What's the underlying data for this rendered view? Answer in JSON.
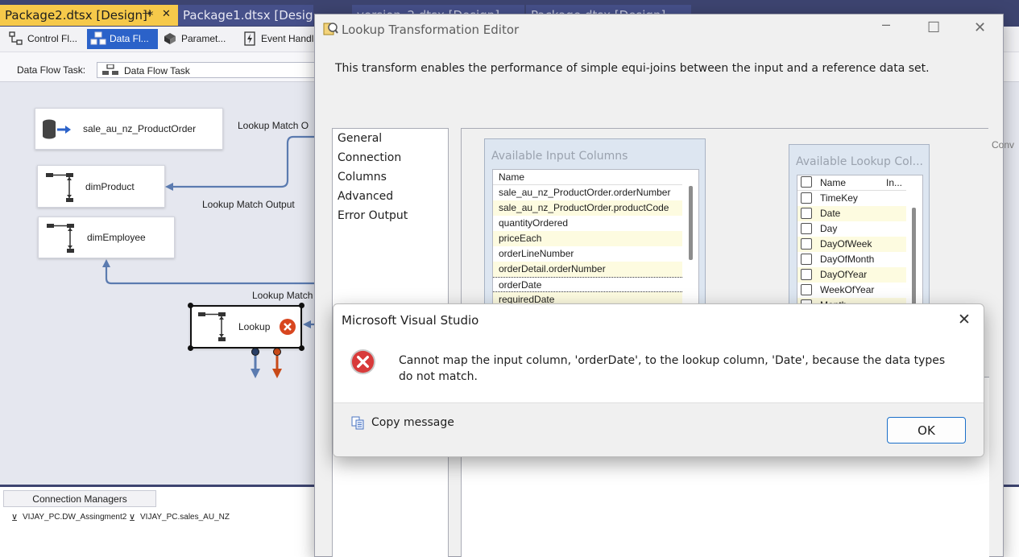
{
  "document_tabs": [
    {
      "label": "Package2.dtsx [Design]*",
      "active": true
    },
    {
      "label": "Package1.dtsx [Design]",
      "active": false
    },
    {
      "label": "version_2.dtsx [Design]",
      "active": false
    },
    {
      "label": "Package.dtsx [Design]",
      "active": false
    }
  ],
  "tab_controls": {
    "pin": "⊣",
    "close": "✕"
  },
  "designer_tabs": [
    {
      "label": "Control Fl...",
      "icon": "control-flow-icon"
    },
    {
      "label": "Data Fl...",
      "icon": "data-flow-icon",
      "active": true
    },
    {
      "label": "Paramet...",
      "icon": "parameters-icon"
    },
    {
      "label": "Event Handl...",
      "icon": "event-handlers-icon"
    }
  ],
  "task_bar": {
    "label": "Data Flow Task:",
    "value": "Data Flow Task"
  },
  "canvas": {
    "nodes": {
      "source": "sale_au_nz_ProductOrder",
      "dim_product": "dimProduct",
      "dim_employee": "dimEmployee",
      "lookup": "Lookup"
    },
    "flow_labels": {
      "top": "Lookup Match O",
      "middle": "Lookup Match Output",
      "bottom": "Lookup Match"
    }
  },
  "connection_managers": {
    "tab": "Connection Managers",
    "items": [
      "VIJAY_PC.DW_Assingment2",
      "VIJAY_PC.sales_AU_NZ"
    ]
  },
  "editor": {
    "title": "Lookup Transformation Editor",
    "description": "This transform enables the performance of simple equi-joins between the input and a reference data set.",
    "nav": [
      "General",
      "Connection",
      "Columns",
      "Advanced",
      "Error Output"
    ],
    "selected_nav": "Columns",
    "right_edge_text": "Conv",
    "input_panel": {
      "title": "Available Input Columns",
      "header": "Name",
      "rows": [
        "sale_au_nz_ProductOrder.orderNumber",
        "sale_au_nz_ProductOrder.productCode",
        "quantityOrdered",
        "priceEach",
        "orderLineNumber",
        "orderDetail.orderNumber",
        "orderDate",
        "requiredDate"
      ]
    },
    "lookup_panel": {
      "title": "Available Lookup Col...",
      "header_name": "Name",
      "header_index": "In...",
      "rows": [
        "TimeKey",
        "Date",
        "Day",
        "DayOfWeek",
        "DayOfMonth",
        "DayOfYear",
        "WeekOfYear",
        "Month"
      ]
    }
  },
  "message_box": {
    "title": "Microsoft Visual Studio",
    "message": "Cannot map the input column, 'orderDate', to the lookup column, 'Date', because the data types do not match.",
    "copy_label": "Copy message",
    "ok_label": "OK",
    "icon": "error-icon",
    "close": "✕"
  },
  "colors": {
    "vs_frame": "#3d4470",
    "active_doc_tab": "#f6c94a",
    "active_designer_tab": "#2b62c9",
    "error_red": "#d83b3b",
    "flow_line": "#5b7bb0",
    "error_arrow": "#c84a18"
  }
}
